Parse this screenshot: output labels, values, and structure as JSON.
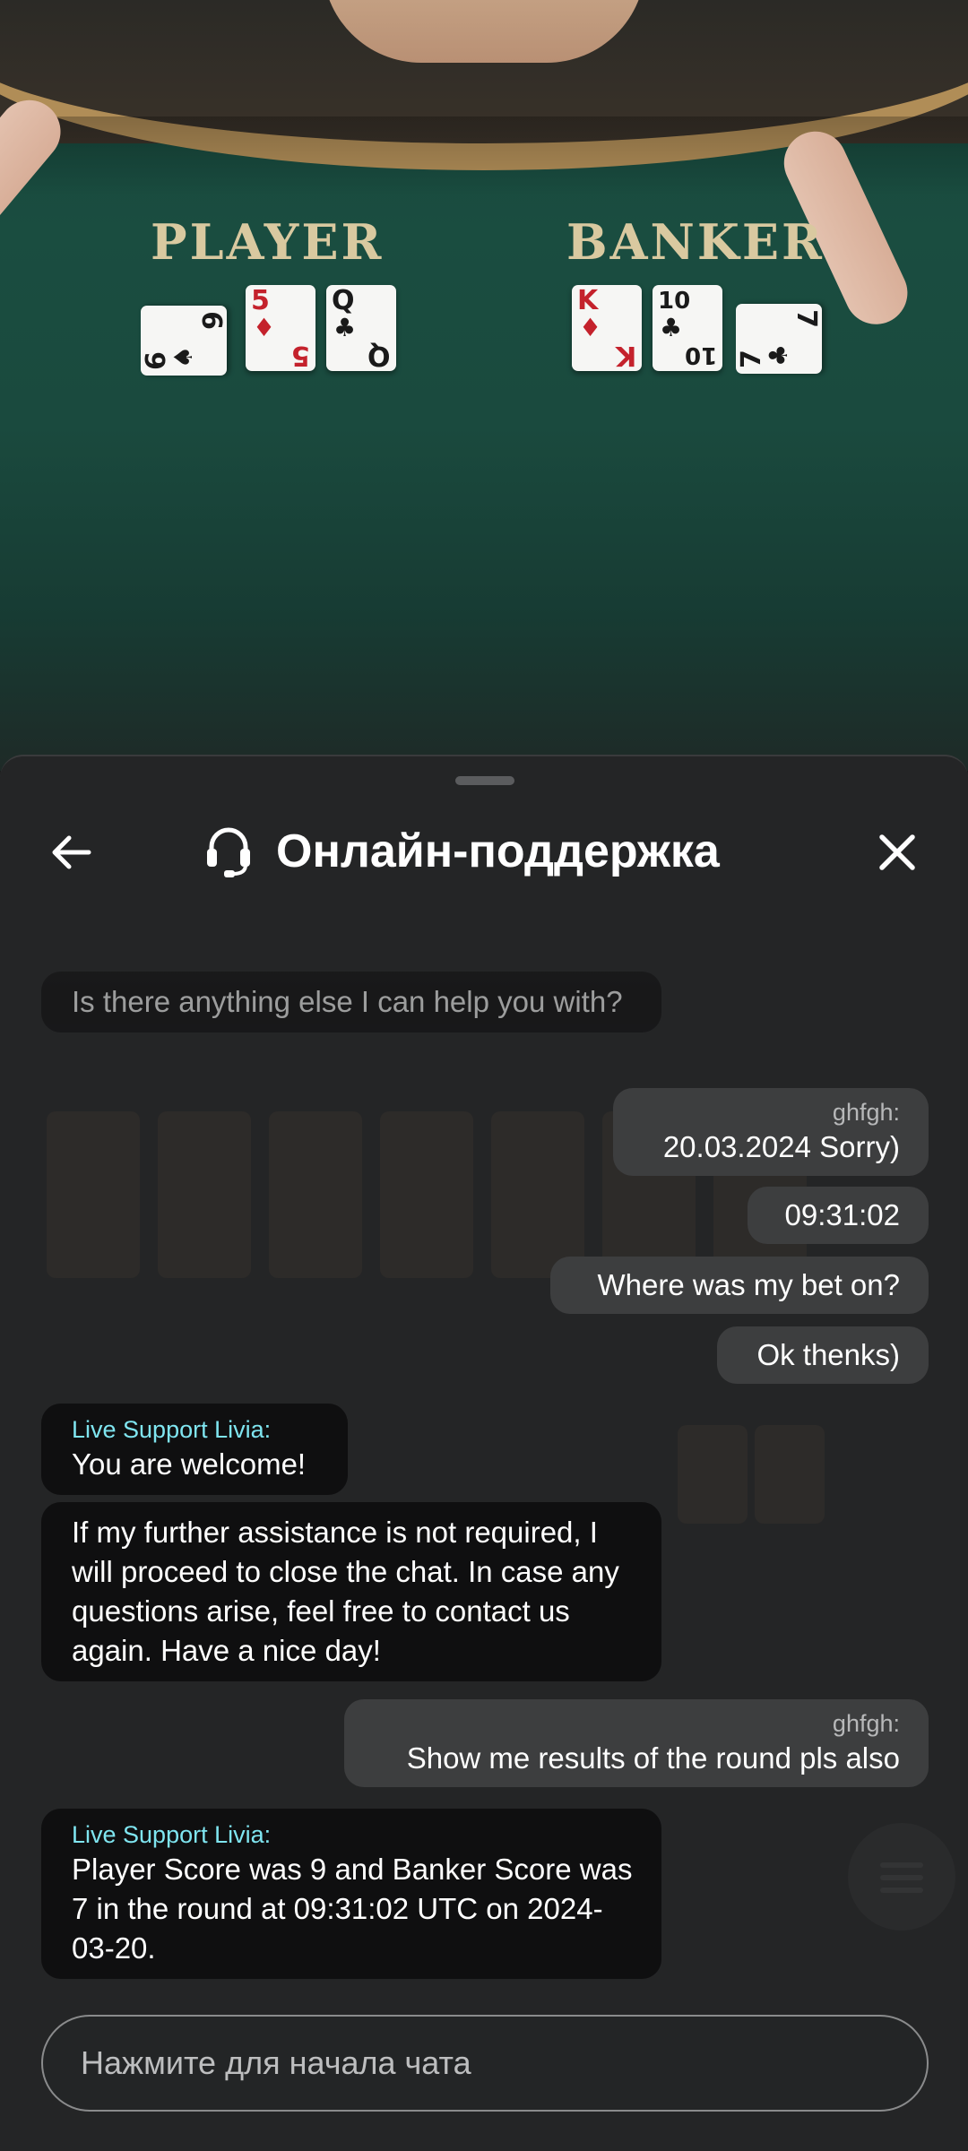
{
  "table": {
    "player_label": "PLAYER",
    "banker_label": "BANKER",
    "player_cards": [
      {
        "rank": "6",
        "suit": "♠",
        "color": "black"
      },
      {
        "rank": "5",
        "suit": "♦",
        "color": "red"
      },
      {
        "rank": "Q",
        "suit": "♣",
        "color": "black"
      }
    ],
    "banker_cards": [
      {
        "rank": "K",
        "suit": "♦",
        "color": "red"
      },
      {
        "rank": "10",
        "suit": "♣",
        "color": "black"
      },
      {
        "rank": "7",
        "suit": "♣",
        "color": "black"
      }
    ]
  },
  "chat": {
    "title": "Онлайн-поддержка",
    "back_icon": "arrow-left-icon",
    "support_icon": "headset-icon",
    "close_icon": "close-icon",
    "colors": {
      "agent_bubble": "#0f0f10",
      "user_bubble": "#3d3e3f",
      "agent_name": "#7fe5f0"
    },
    "messages": [
      {
        "from": "agent",
        "sender": "",
        "text": "Is there anything else I can help you with?"
      },
      {
        "from": "user",
        "sender": "ghfgh:",
        "text": "20.03.2024 Sorry)"
      },
      {
        "from": "user",
        "sender": "",
        "text": "09:31:02"
      },
      {
        "from": "user",
        "sender": "",
        "text": "Where was my bet on?"
      },
      {
        "from": "user",
        "sender": "",
        "text": "Ok thenks)"
      },
      {
        "from": "agent",
        "sender": "Live Support Livia:",
        "text": "You are welcome!"
      },
      {
        "from": "agent",
        "sender": "",
        "text": "If my further assistance is not required, I will proceed to close the chat. In case any questions arise, feel free to contact us again. Have a nice day!"
      },
      {
        "from": "user",
        "sender": "ghfgh:",
        "text": "Show me results of the round pls also"
      },
      {
        "from": "agent",
        "sender": "Live Support Livia:",
        "text": "Player Score was 9 and Banker Score was 7 in the round at 09:31:02 UTC on 2024-03-20."
      }
    ],
    "input_placeholder": "Нажмите для начала чата"
  }
}
